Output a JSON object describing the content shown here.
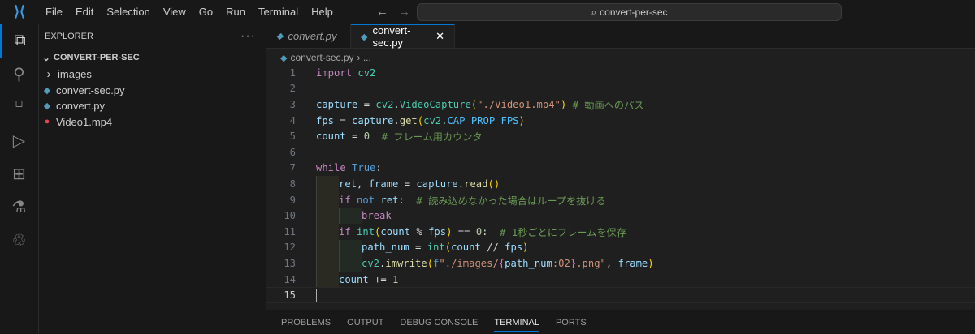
{
  "menu": [
    "File",
    "Edit",
    "Selection",
    "View",
    "Go",
    "Run",
    "Terminal",
    "Help"
  ],
  "search": "convert-per-sec",
  "explorer": {
    "title": "EXPLORER",
    "more": "···",
    "folder": "CONVERT-PER-SEC",
    "items": [
      {
        "label": "images",
        "type": "folder"
      },
      {
        "label": "convert-sec.py",
        "type": "python"
      },
      {
        "label": "convert.py",
        "type": "python"
      },
      {
        "label": "Video1.mp4",
        "type": "video"
      }
    ]
  },
  "tabs": [
    {
      "label": "convert.py",
      "active": false
    },
    {
      "label": "convert-sec.py",
      "active": true,
      "close": "✕"
    }
  ],
  "breadcrumb": {
    "file": "convert-sec.py",
    "rest": "› ..."
  },
  "code": [
    {
      "n": "1",
      "ind": 0,
      "t": [
        [
          "import",
          "kw"
        ],
        [
          " ",
          "op"
        ],
        [
          "cv2",
          "cls"
        ]
      ]
    },
    {
      "n": "2",
      "ind": 0,
      "t": []
    },
    {
      "n": "3",
      "ind": 0,
      "t": [
        [
          "capture",
          "var"
        ],
        [
          " = ",
          "op"
        ],
        [
          "cv2",
          "cls"
        ],
        [
          ".",
          "op"
        ],
        [
          "VideoCapture",
          "cls"
        ],
        [
          "(",
          "br1"
        ],
        [
          "\"./Video1.mp4\"",
          "str"
        ],
        [
          ")",
          "br1"
        ],
        [
          " ",
          "op"
        ],
        [
          "# 動画へのパス",
          "cm"
        ]
      ]
    },
    {
      "n": "4",
      "ind": 0,
      "t": [
        [
          "fps",
          "var"
        ],
        [
          " = ",
          "op"
        ],
        [
          "capture",
          "var"
        ],
        [
          ".",
          "op"
        ],
        [
          "get",
          "fn"
        ],
        [
          "(",
          "br1"
        ],
        [
          "cv2",
          "cls"
        ],
        [
          ".",
          "op"
        ],
        [
          "CAP_PROP_FPS",
          "const"
        ],
        [
          ")",
          "br1"
        ]
      ]
    },
    {
      "n": "5",
      "ind": 0,
      "t": [
        [
          "count",
          "var"
        ],
        [
          " = ",
          "op"
        ],
        [
          "0",
          "nm"
        ],
        [
          "  ",
          "op"
        ],
        [
          "# フレーム用カウンタ",
          "cm"
        ]
      ]
    },
    {
      "n": "6",
      "ind": 0,
      "t": []
    },
    {
      "n": "7",
      "ind": 0,
      "t": [
        [
          "while",
          "kw"
        ],
        [
          " ",
          "op"
        ],
        [
          "True",
          "bl"
        ],
        [
          ":",
          "op"
        ]
      ]
    },
    {
      "n": "8",
      "ind": 1,
      "t": [
        [
          "ret",
          "var"
        ],
        [
          ", ",
          "op"
        ],
        [
          "frame",
          "var"
        ],
        [
          " = ",
          "op"
        ],
        [
          "capture",
          "var"
        ],
        [
          ".",
          "op"
        ],
        [
          "read",
          "fn"
        ],
        [
          "()",
          "br1"
        ]
      ]
    },
    {
      "n": "9",
      "ind": 1,
      "t": [
        [
          "if",
          "kw"
        ],
        [
          " ",
          "op"
        ],
        [
          "not",
          "bl"
        ],
        [
          " ",
          "op"
        ],
        [
          "ret",
          "var"
        ],
        [
          ":  ",
          "op"
        ],
        [
          "# 読み込めなかった場合はループを抜ける",
          "cm"
        ]
      ]
    },
    {
      "n": "10",
      "ind": 2,
      "t": [
        [
          "break",
          "kw"
        ]
      ]
    },
    {
      "n": "11",
      "ind": 1,
      "t": [
        [
          "if",
          "kw"
        ],
        [
          " ",
          "op"
        ],
        [
          "int",
          "cls"
        ],
        [
          "(",
          "br1"
        ],
        [
          "count",
          "var"
        ],
        [
          " % ",
          "op"
        ],
        [
          "fps",
          "var"
        ],
        [
          ")",
          "br1"
        ],
        [
          " == ",
          "op"
        ],
        [
          "0",
          "nm"
        ],
        [
          ":  ",
          "op"
        ],
        [
          "# 1秒ごとにフレームを保存",
          "cm"
        ]
      ]
    },
    {
      "n": "12",
      "ind": 2,
      "t": [
        [
          "path_num",
          "var"
        ],
        [
          " = ",
          "op"
        ],
        [
          "int",
          "cls"
        ],
        [
          "(",
          "br1"
        ],
        [
          "count",
          "var"
        ],
        [
          " // ",
          "op"
        ],
        [
          "fps",
          "var"
        ],
        [
          ")",
          "br1"
        ]
      ]
    },
    {
      "n": "13",
      "ind": 2,
      "t": [
        [
          "cv2",
          "cls"
        ],
        [
          ".",
          "op"
        ],
        [
          "imwrite",
          "fn"
        ],
        [
          "(",
          "br1"
        ],
        [
          "f",
          "bl"
        ],
        [
          "\"./images/",
          "str"
        ],
        [
          "{",
          "br2"
        ],
        [
          "path_num",
          "var"
        ],
        [
          ":02",
          "str"
        ],
        [
          "}",
          "br2"
        ],
        [
          ".png\"",
          "str"
        ],
        [
          ", ",
          "op"
        ],
        [
          "frame",
          "var"
        ],
        [
          ")",
          "br1"
        ]
      ]
    },
    {
      "n": "14",
      "ind": 1,
      "t": [
        [
          "count",
          "var"
        ],
        [
          " += ",
          "op"
        ],
        [
          "1",
          "nm"
        ]
      ]
    },
    {
      "n": "15",
      "ind": 0,
      "t": [],
      "current": true
    }
  ],
  "panel": {
    "tabs": [
      "PROBLEMS",
      "OUTPUT",
      "DEBUG CONSOLE",
      "TERMINAL",
      "PORTS"
    ],
    "active": "TERMINAL"
  }
}
